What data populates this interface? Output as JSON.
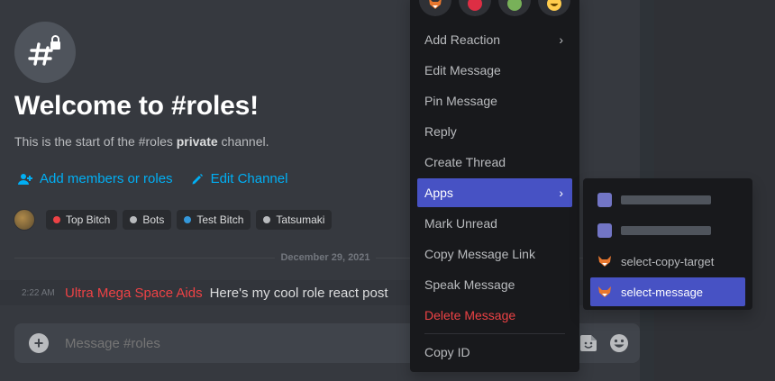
{
  "channel": {
    "welcome_title": "Welcome to #roles!",
    "start_prefix": "This is the start of the #roles ",
    "start_bold": "private",
    "start_suffix": " channel."
  },
  "actions": {
    "add_members": "Add members or roles",
    "edit_channel": "Edit Channel"
  },
  "roles": [
    {
      "name": "Top Bitch",
      "color": "#ed4245"
    },
    {
      "name": "Bots",
      "color": "#b9bbbe"
    },
    {
      "name": "Test Bitch",
      "color": "#3498db"
    },
    {
      "name": "Tatsumaki",
      "color": "#b9bbbe"
    }
  ],
  "divider": {
    "date": "December 29, 2021"
  },
  "message": {
    "time": "2:22 AM",
    "author": "Ultra Mega Space Aids",
    "text": "Here's my cool role react post"
  },
  "composer": {
    "placeholder": "Message #roles"
  },
  "context_menu": {
    "items": [
      {
        "label": "Add Reaction",
        "has_submenu": true
      },
      {
        "label": "Edit Message"
      },
      {
        "label": "Pin Message"
      },
      {
        "label": "Reply"
      },
      {
        "label": "Create Thread"
      },
      {
        "label": "Apps",
        "has_submenu": true,
        "active": true
      },
      {
        "label": "Mark Unread"
      },
      {
        "label": "Copy Message Link"
      },
      {
        "label": "Speak Message"
      },
      {
        "label": "Delete Message",
        "danger": true
      },
      {
        "label": "Copy ID"
      }
    ],
    "reactions": [
      "fox-face-icon",
      "red-circle-icon",
      "green-circle-icon",
      "grinning-face-icon"
    ]
  },
  "apps_submenu": {
    "items": [
      {
        "label": ""
      },
      {
        "label": ""
      },
      {
        "label": "select-copy-target"
      },
      {
        "label": "select-message",
        "active": true
      }
    ]
  },
  "colors": {
    "accent": "#4752c4",
    "link": "#00aff4",
    "danger": "#ed4245"
  }
}
